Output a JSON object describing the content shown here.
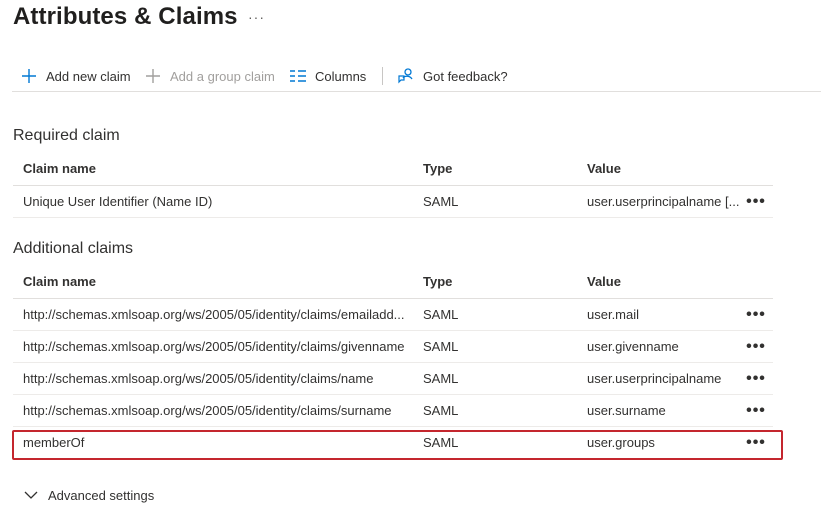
{
  "header": {
    "title": "Attributes & Claims",
    "more": "···"
  },
  "toolbar": {
    "add_claim": "Add new claim",
    "add_group_claim": "Add a group claim",
    "columns": "Columns",
    "feedback": "Got feedback?"
  },
  "required": {
    "title": "Required claim",
    "columns": {
      "name": "Claim name",
      "type": "Type",
      "value": "Value"
    },
    "rows": [
      {
        "name": "Unique User Identifier (Name ID)",
        "type": "SAML",
        "value": "user.userprincipalname [...",
        "more": "•••"
      }
    ]
  },
  "additional": {
    "title": "Additional claims",
    "columns": {
      "name": "Claim name",
      "type": "Type",
      "value": "Value"
    },
    "rows": [
      {
        "name": "http://schemas.xmlsoap.org/ws/2005/05/identity/claims/emailadd...",
        "type": "SAML",
        "value": "user.mail",
        "more": "•••"
      },
      {
        "name": "http://schemas.xmlsoap.org/ws/2005/05/identity/claims/givenname",
        "type": "SAML",
        "value": "user.givenname",
        "more": "•••"
      },
      {
        "name": "http://schemas.xmlsoap.org/ws/2005/05/identity/claims/name",
        "type": "SAML",
        "value": "user.userprincipalname",
        "more": "•••"
      },
      {
        "name": "http://schemas.xmlsoap.org/ws/2005/05/identity/claims/surname",
        "type": "SAML",
        "value": "user.surname",
        "more": "•••"
      },
      {
        "name": "memberOf",
        "type": "SAML",
        "value": "user.groups",
        "more": "•••"
      }
    ]
  },
  "advanced": {
    "label": "Advanced settings"
  },
  "colors": {
    "accent": "#0078d4",
    "highlight": "#c4262e",
    "disabled": "#a19f9d"
  }
}
